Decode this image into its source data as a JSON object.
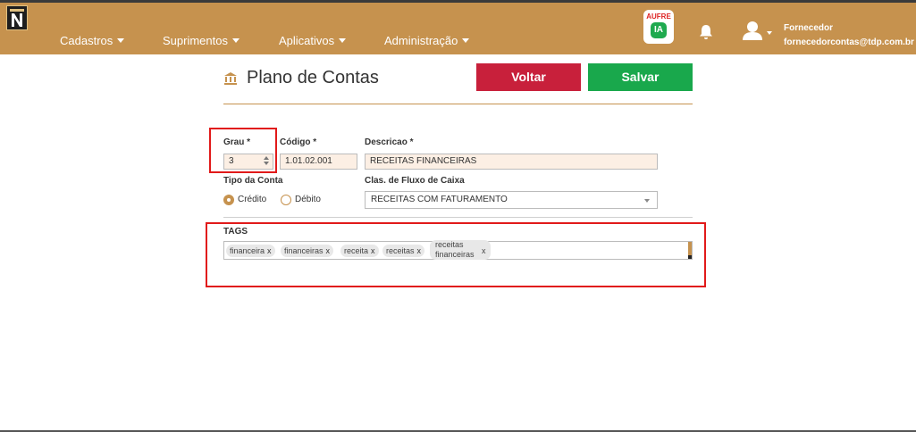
{
  "brand": {
    "logo_letter": "N"
  },
  "nav": [
    {
      "label": "Cadastros"
    },
    {
      "label": "Suprimentos"
    },
    {
      "label": "Aplicativos"
    },
    {
      "label": "Administração"
    }
  ],
  "header": {
    "aufre_label": "AUFRE",
    "ia_label": "IA",
    "user_name": "Fornecedor",
    "user_email": "fornecedorcontas@tdp.com.br"
  },
  "page": {
    "title": "Plano de Contas",
    "back_label": "Voltar",
    "save_label": "Salvar"
  },
  "form": {
    "grau": {
      "label": "Grau *",
      "value": "3"
    },
    "codigo": {
      "label": "Código *",
      "value": "1.01.02.001"
    },
    "descricao": {
      "label": "Descricao *",
      "value": "RECEITAS FINANCEIRAS"
    },
    "tipo_conta": {
      "label": "Tipo da Conta",
      "options": [
        "Crédito",
        "Débito"
      ],
      "selected": "Crédito"
    },
    "fluxo": {
      "label": "Clas. de Fluxo de Caixa",
      "value": "RECEITAS COM FATURAMENTO"
    },
    "tags": {
      "label": "TAGS",
      "items": [
        "financeira",
        "financeiras",
        "receita",
        "receitas"
      ],
      "multiline_tag": [
        "receitas",
        "financeiras"
      ],
      "remove_glyph": "x"
    }
  },
  "colors": {
    "header_bg": "#c6924e",
    "voltar": "#c8203b",
    "salvar": "#19a84c",
    "highlight": "#e11a1a"
  }
}
